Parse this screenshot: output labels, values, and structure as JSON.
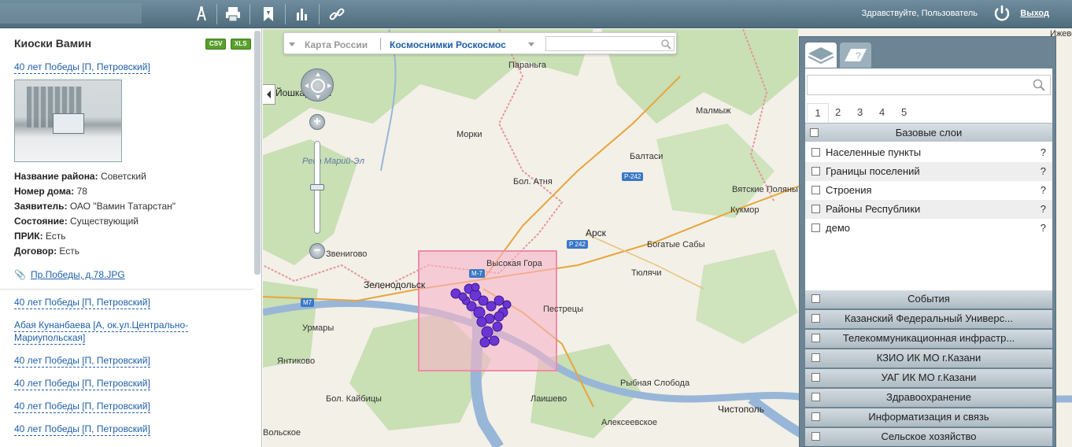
{
  "header": {
    "greeting": "Здравствуйте, Пользователь",
    "logout_label": "Выход",
    "icons": [
      "compass-icon",
      "print-icon",
      "bookmark-icon",
      "chart-icon",
      "link-icon",
      "power-icon"
    ]
  },
  "left_panel": {
    "title": "Киоски Вамин",
    "badges": [
      "CSV",
      "XLS"
    ],
    "selected_item": "40 лет Победы [П, Петровский]",
    "properties": [
      {
        "label": "Название района:",
        "value": "Советский"
      },
      {
        "label": "Номер дома:",
        "value": "78"
      },
      {
        "label": "Заявитель:",
        "value": "ОАО \"Вамин Татарстан\""
      },
      {
        "label": "Состояние:",
        "value": "Существующий"
      },
      {
        "label": "ПРИК:",
        "value": "Есть"
      },
      {
        "label": "Договор:",
        "value": "Есть"
      }
    ],
    "attachment": "Пр.Победы, д.78.JPG",
    "items": [
      "40 лет Победы [П, Петровский]",
      "Абая Кунанбаева [А, ок.ул.Центрально-",
      "Мариупольская]",
      "40 лет Победы [П, Петровский]",
      "40 лет Победы [П, Петровский]",
      "40 лет Победы [П, Петровский]",
      "40 лет Победы [П, Петровский]"
    ]
  },
  "map": {
    "base_layers": [
      "Карта России",
      "Космоснимки Роскосмос"
    ],
    "active_base": "Космоснимки Роскосмос",
    "labels": [
      "Йошкар-Ола",
      "Параньга",
      "Малмыж",
      "Морки",
      "Балтаси",
      "Бол. Атня",
      "Вятские Поляны",
      "Кукмор",
      "Арск",
      "Богатые Сабы",
      "Тюлячи",
      "Высокая Гора",
      "Зеленодольск",
      "Пестрецы",
      "Урмары",
      "Янтиково",
      "Бол. Кайбицы",
      "Рыбная Слобода",
      "Лаишево",
      "Алексеевское",
      "Чистополь",
      "Река Марий-Эл",
      "Звенигово",
      "Ижевск",
      "Вольское"
    ],
    "roads": [
      "Р-242",
      "Р 242",
      "М-7",
      "М7"
    ],
    "colors": {
      "selection": "#f7b4c8",
      "points": "#6b35d6",
      "water": "#9fbbd9",
      "forest": "#c7dfb1"
    }
  },
  "layers_panel": {
    "search_placeholder": "",
    "pages": [
      "1",
      "2",
      "3",
      "4",
      "5"
    ],
    "active_page": "1",
    "base_group": "Базовые слои",
    "base_layers": [
      "Населенные пункты",
      "Границы поселений",
      "Строения",
      "Районы Республики",
      "демо"
    ],
    "help": "?",
    "groups": [
      "События",
      "Казанский Федеральный Универс...",
      "Телекоммуникационная инфрастр...",
      "КЗИО ИК МО г.Казани",
      "УАГ ИК МО г.Казани",
      "Здравоохранение",
      "Информатизация и связь",
      "Сельское хозяйство"
    ]
  }
}
